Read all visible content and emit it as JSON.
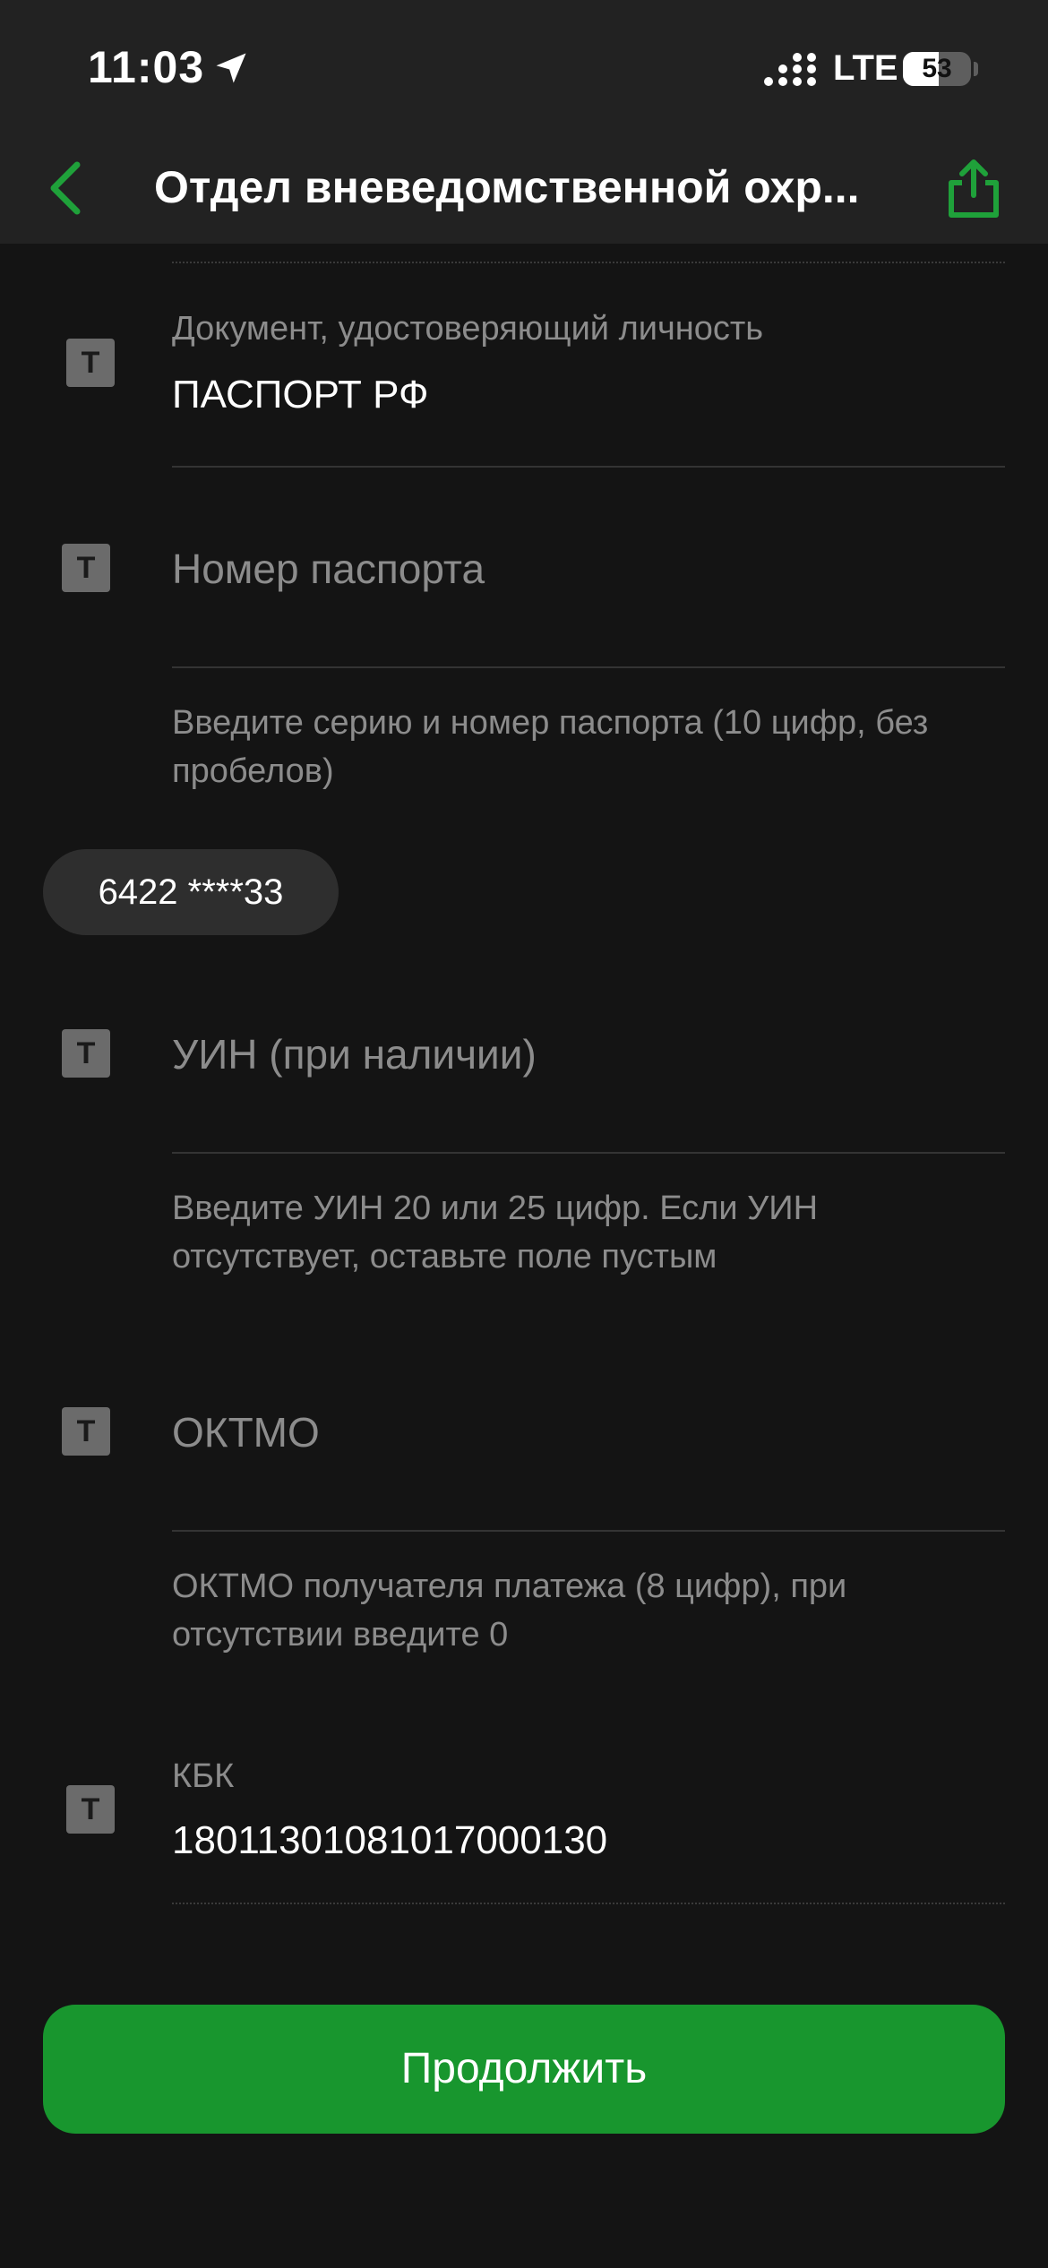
{
  "status_bar": {
    "time": "11:03",
    "network": "LTE",
    "battery_level": "53",
    "icons": [
      "location-arrow-icon",
      "signal-icon",
      "battery-icon"
    ]
  },
  "header": {
    "title": "Отдел вневедомственной охр...",
    "icons": [
      "chevron-left-icon",
      "share-icon"
    ],
    "accent_color": "#1fa13a"
  },
  "form": {
    "document": {
      "label": "Документ, удостоверяющий личность",
      "value": "ПАСПОРТ РФ",
      "icon_text": "T"
    },
    "passport_number": {
      "placeholder": "Номер паспорта",
      "hint": "Введите серию и номер паспорта (10 цифр, без пробелов)",
      "icon_text": "T",
      "suggestion": "6422 ****33"
    },
    "uin": {
      "placeholder": "УИН (при наличии)",
      "hint": "Введите УИН 20 или 25 цифр. Если УИН отсутствует, оставьте поле пустым",
      "icon_text": "T"
    },
    "oktmo": {
      "placeholder": "ОКТМО",
      "hint": "ОКТМО получателя платежа (8 цифр), при отсутствии введите 0",
      "icon_text": "T"
    },
    "kbk": {
      "label": "КБК",
      "value": "18011301081017000130",
      "icon_text": "T"
    }
  },
  "actions": {
    "continue_label": "Продолжить",
    "button_color": "#18962e"
  }
}
